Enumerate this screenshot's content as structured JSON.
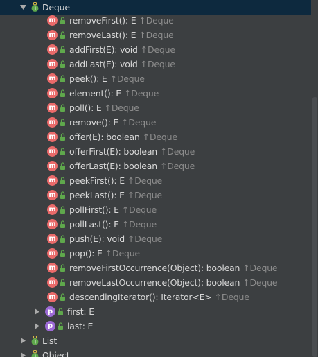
{
  "root": {
    "label": "Deque",
    "expanded": true,
    "icon": "interface-icon"
  },
  "methods": [
    {
      "sig": "removeFirst(): E",
      "owner": "Deque"
    },
    {
      "sig": "removeLast(): E",
      "owner": "Deque"
    },
    {
      "sig": "addFirst(E): void",
      "owner": "Deque"
    },
    {
      "sig": "addLast(E): void",
      "owner": "Deque"
    },
    {
      "sig": "peek(): E",
      "owner": "Deque"
    },
    {
      "sig": "element(): E",
      "owner": "Deque"
    },
    {
      "sig": "poll(): E",
      "owner": "Deque"
    },
    {
      "sig": "remove(): E",
      "owner": "Deque"
    },
    {
      "sig": "offer(E): boolean",
      "owner": "Deque"
    },
    {
      "sig": "offerFirst(E): boolean",
      "owner": "Deque"
    },
    {
      "sig": "offerLast(E): boolean",
      "owner": "Deque"
    },
    {
      "sig": "peekFirst(): E",
      "owner": "Deque"
    },
    {
      "sig": "peekLast(): E",
      "owner": "Deque"
    },
    {
      "sig": "pollFirst(): E",
      "owner": "Deque"
    },
    {
      "sig": "pollLast(): E",
      "owner": "Deque"
    },
    {
      "sig": "push(E): void",
      "owner": "Deque"
    },
    {
      "sig": "pop(): E",
      "owner": "Deque"
    },
    {
      "sig": "removeFirstOccurrence(Object): boolean",
      "owner": "Deque"
    },
    {
      "sig": "removeLastOccurrence(Object): boolean",
      "owner": "Deque"
    },
    {
      "sig": "descendingIterator(): Iterator<E>",
      "owner": "Deque"
    }
  ],
  "properties": [
    {
      "label": "first: E",
      "icon": "p"
    },
    {
      "label": "last: E",
      "icon": "p"
    }
  ],
  "supertypes": [
    {
      "label": "List"
    },
    {
      "label": "Object"
    }
  ],
  "owner_arrow": "↑",
  "method_icon_letter": "m",
  "colors": {
    "background": "#3c3f41",
    "selected_row": "#0d293e",
    "method_icon": "#ea6a6a",
    "property_icon": "#9d6bd6",
    "text": "#bbbbbb",
    "owner_text": "#8c8c8c"
  }
}
